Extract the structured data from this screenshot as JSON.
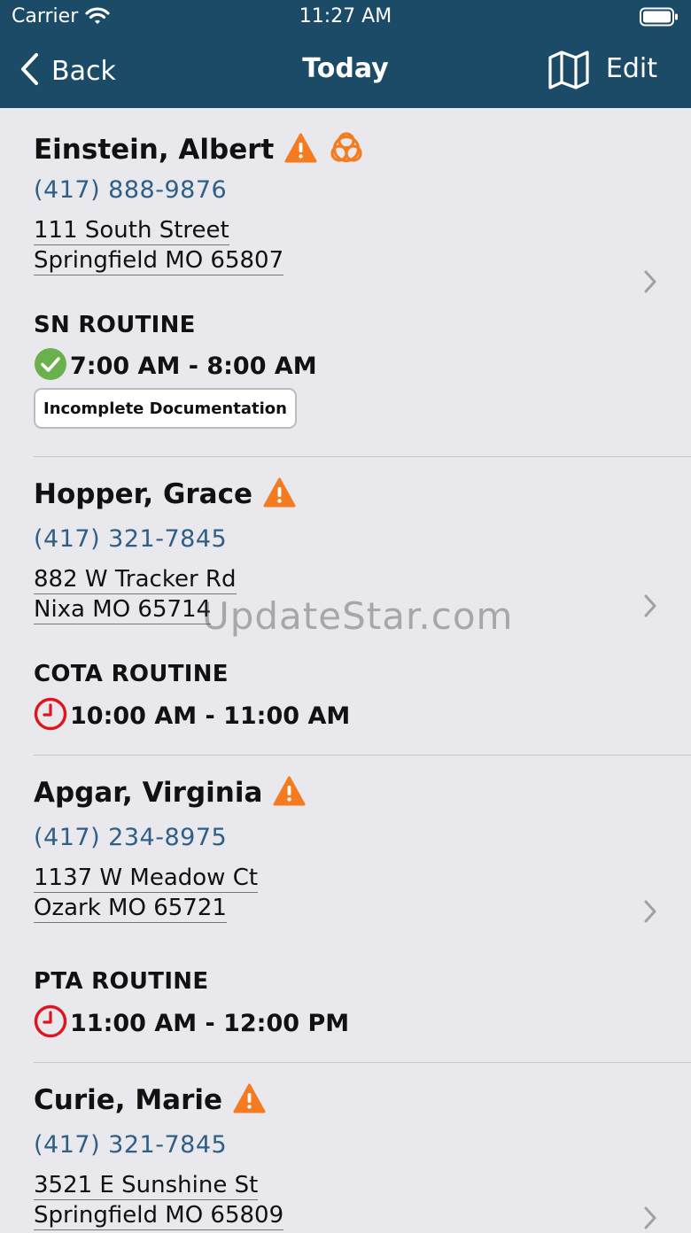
{
  "status_bar": {
    "carrier": "Carrier",
    "time": "11:27 AM"
  },
  "nav": {
    "back_label": "Back",
    "title": "Today",
    "edit_label": "Edit"
  },
  "patients": [
    {
      "name": "Einstein, Albert",
      "phone": "(417) 888-9876",
      "address_line1": "111 South Street",
      "address_line2": "Springfield MO 65807",
      "service": "SN ROUTINE",
      "time": "7:00 AM - 8:00 AM",
      "status_icon": "check-complete-icon",
      "badge": "Incomplete Documentation",
      "alerts": [
        "warning-icon",
        "biohazard-icon"
      ]
    },
    {
      "name": "Hopper, Grace",
      "phone": "(417) 321-7845",
      "address_line1": "882 W Tracker Rd",
      "address_line2": "Nixa MO 65714",
      "service": "COTA ROUTINE",
      "time": "10:00 AM - 11:00 AM",
      "status_icon": "clock-icon",
      "alerts": [
        "warning-icon"
      ]
    },
    {
      "name": "Apgar, Virginia",
      "phone": "(417) 234-8975",
      "address_line1": "1137 W Meadow Ct",
      "address_line2": "Ozark MO 65721",
      "service": "PTA ROUTINE",
      "time": "11:00 AM - 12:00 PM",
      "status_icon": "clock-icon",
      "alerts": [
        "warning-icon"
      ]
    },
    {
      "name": "Curie, Marie",
      "phone": "(417) 321-7845",
      "address_line1": "3521 E Sunshine St",
      "address_line2": "Springfield MO 65809",
      "alerts": [
        "warning-icon"
      ]
    }
  ],
  "watermark": "UpdateStar.com",
  "colors": {
    "nav_bg": "#1c4b68",
    "page_bg": "#e8e8ed",
    "phone_text": "#2f5f86",
    "warning": "#f47b20",
    "complete_green": "#6ab04c",
    "clock_red": "#e0141e"
  }
}
